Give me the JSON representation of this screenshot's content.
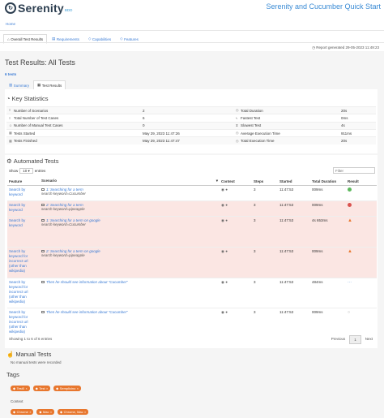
{
  "header": {
    "logo_text": "Serenity",
    "logo_suffix": "BDD",
    "title": "Serenity and Cucumber Quick Start",
    "breadcrumb": "Home"
  },
  "nav_tabs": [
    {
      "label": "Overall Test Results",
      "icon": "home-icon",
      "active": true
    },
    {
      "label": "Requirements",
      "icon": "book-icon",
      "active": false
    },
    {
      "label": "Capabilities",
      "icon": "tag-icon",
      "active": false
    },
    {
      "label": "Features",
      "icon": "tag-icon",
      "active": false
    }
  ],
  "report_generated": "Report generated 29-05-2023 11:49:23",
  "results_title": "Test Results: All Tests",
  "tests_count": "6 tests",
  "sub_tabs": [
    {
      "label": "Summary",
      "icon": "bar-chart-icon",
      "active": false
    },
    {
      "label": "Test Results",
      "icon": "grid-icon",
      "active": true
    }
  ],
  "key_statistics": {
    "heading": "Key Statistics",
    "rows": [
      {
        "label1": "Number of Scenarios",
        "value1": "2",
        "label2": "Total Duration",
        "value2": "20s"
      },
      {
        "label1": "Total Number of Test Cases",
        "value1": "6",
        "label2": "Fastest Test",
        "value2": "0ms"
      },
      {
        "label1": "Number of Manual Test Cases",
        "value1": "0",
        "label2": "Slowest Test",
        "value2": "4s"
      },
      {
        "label1": "Tests Started",
        "value1": "May 29, 2023 11:47:26",
        "label2": "Average Execution Time",
        "value2": "911ms"
      },
      {
        "label1": "Tests Finished",
        "value1": "May 29, 2023 11:47:47",
        "label2": "Total Execution Time",
        "value2": "20s"
      }
    ]
  },
  "automated_tests": {
    "heading": "Automated Tests",
    "show_label": "Show",
    "entries_value": "10",
    "entries_label": "entries",
    "filter_placeholder": "Filter",
    "columns": [
      "Feature",
      "Scenario",
      "Context",
      "Steps",
      "Started",
      "Total Duration",
      "Result"
    ],
    "rows": [
      {
        "feature": "Search by keyword",
        "scenario": "1: Searching for a term",
        "scenario_sub": "search keyword=Cucumber",
        "steps": "3",
        "started": "11:47:53",
        "duration": "009ms",
        "result": "success",
        "status_color": "#5cb85c"
      },
      {
        "feature": "Search by keyword",
        "scenario": "2: Searching for a term",
        "scenario_sub": "search keyword=pipeapple",
        "steps": "3",
        "started": "11:47:53",
        "duration": "009ms",
        "result": "error",
        "status_color": "#d9534f"
      },
      {
        "feature": "Search by keyword",
        "scenario": "1: Searching for a term on google",
        "scenario_sub": "search keyword=Cucumber",
        "steps": "3",
        "started": "11:47:53",
        "duration": "4s 653ms",
        "result": "warning",
        "status_color": "#e8772e"
      },
      {
        "feature": "Search by keyword for incorrect url (other than wikipedia)",
        "scenario": "2: Searching for a term on google",
        "scenario_sub": "search keyword=pipeapple",
        "steps": "3",
        "started": "11:47:53",
        "duration": "009ms",
        "result": "warning",
        "status_color": "#e8772e"
      },
      {
        "feature": "Search by keyword for incorrect url (other than wikipedia)",
        "scenario": "Then he should see information about \"Cucumber\"",
        "scenario_sub": "",
        "steps": "3",
        "started": "11:47:53",
        "duration": "484ms",
        "result": "pending",
        "status_color": "#3a7bd5"
      },
      {
        "feature": "Search by keyword for incorrect url (other than wikipedia)",
        "scenario": "Then he should see information about \"Cucumber\"",
        "scenario_sub": "",
        "steps": "3",
        "started": "11:47:53",
        "duration": "009ms",
        "result": "ignored",
        "status_color": "#999999"
      }
    ],
    "showing": "Showing 1 to 6 of 6 entries",
    "pager": {
      "previous": "Previous",
      "current": "1",
      "next": "Next"
    }
  },
  "manual_tests": {
    "heading": "Manual Tests",
    "message": "No manual tests were recorded"
  },
  "tags": {
    "heading": "Tags",
    "row1": [
      "Test0",
      "Test",
      "Semplicino"
    ],
    "context_label": "Context",
    "row2": [
      "Chrome",
      "Mac",
      "Chrome, Mac"
    ]
  }
}
